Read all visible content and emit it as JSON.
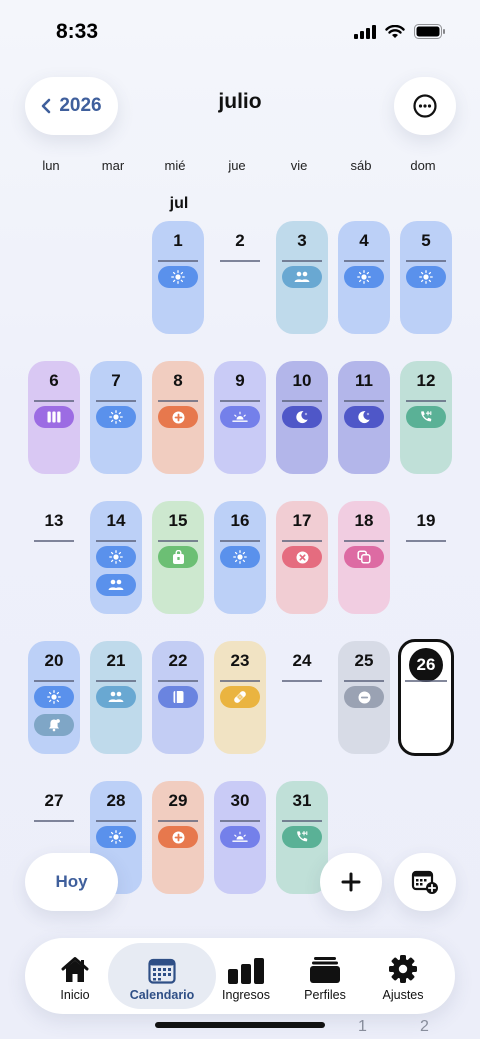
{
  "status_bar": {
    "time": "8:33"
  },
  "header": {
    "year_label": "2026",
    "month_title": "julio"
  },
  "weekdays": [
    "lun",
    "mar",
    "mié",
    "jue",
    "vie",
    "sáb",
    "dom"
  ],
  "month_short": "jul",
  "days": [
    {
      "day": "1",
      "colors": [
        "#bcd0f7",
        "#5a91ec"
      ],
      "badges": [
        "sun-icon"
      ]
    },
    {
      "day": "2",
      "colors": null,
      "badges": []
    },
    {
      "day": "3",
      "colors": [
        "#bfdaeb",
        "#69a8d2"
      ],
      "badges": [
        "people-icon"
      ]
    },
    {
      "day": "4",
      "colors": [
        "#bcd0f7",
        "#5a91ec"
      ],
      "badges": [
        "sun-icon"
      ]
    },
    {
      "day": "5",
      "colors": [
        "#bcd0f7",
        "#5a91ec"
      ],
      "badges": [
        "sun-icon"
      ]
    },
    {
      "day": "6",
      "colors": [
        "#d9c8f3",
        "#9c6ce3"
      ],
      "badges": [
        "columns-icon"
      ]
    },
    {
      "day": "7",
      "colors": [
        "#bcd0f7",
        "#5a91ec"
      ],
      "badges": [
        "sun-icon"
      ]
    },
    {
      "day": "8",
      "colors": [
        "#f1cdc0",
        "#e7784d"
      ],
      "badges": [
        "plus-circle-icon"
      ]
    },
    {
      "day": "9",
      "colors": [
        "#c9cbf6",
        "#7480ea"
      ],
      "badges": [
        "sunrise-icon"
      ]
    },
    {
      "day": "10",
      "colors": [
        "#b3b6ea",
        "#4f57c8"
      ],
      "badges": [
        "moon-icon"
      ]
    },
    {
      "day": "11",
      "colors": [
        "#b3b6ea",
        "#4f57c8"
      ],
      "badges": [
        "moon-icon"
      ]
    },
    {
      "day": "12",
      "colors": [
        "#c0e0d8",
        "#5ab196"
      ],
      "badges": [
        "phone-icon"
      ]
    },
    {
      "day": "13",
      "colors": null,
      "badges": []
    },
    {
      "day": "14",
      "colors": [
        "#bcd0f7",
        "#5a91ec"
      ],
      "badges": [
        "sun-icon",
        "people-icon"
      ]
    },
    {
      "day": "15",
      "colors": [
        "#cde8cf",
        "#6cbf74"
      ],
      "badges": [
        "bag-icon"
      ]
    },
    {
      "day": "16",
      "colors": [
        "#bcd0f7",
        "#5a91ec"
      ],
      "badges": [
        "sun-icon"
      ]
    },
    {
      "day": "17",
      "colors": [
        "#f1cdd3",
        "#e56c7f"
      ],
      "badges": [
        "x-circle-icon"
      ]
    },
    {
      "day": "18",
      "colors": [
        "#f1cde1",
        "#dd6ba3"
      ],
      "badges": [
        "copy-icon"
      ]
    },
    {
      "day": "19",
      "colors": null,
      "badges": []
    },
    {
      "day": "20",
      "colors": [
        "#bcd0f7",
        "#5a91ec"
      ],
      "badges": [
        "sun-icon",
        "bell-icon"
      ]
    },
    {
      "day": "21",
      "colors": [
        "#bfdaeb",
        "#69a8d2"
      ],
      "badges": [
        "people-icon"
      ]
    },
    {
      "day": "22",
      "colors": [
        "#c3cdf4",
        "#6a84e0"
      ],
      "badges": [
        "book-icon"
      ]
    },
    {
      "day": "23",
      "colors": [
        "#f1e3c3",
        "#eab440"
      ],
      "badges": [
        "bandage-icon"
      ]
    },
    {
      "day": "24",
      "colors": null,
      "badges": []
    },
    {
      "day": "25",
      "colors": [
        "#d7dbe6",
        "#9aa2b3"
      ],
      "badges": [
        "minus-circle-icon"
      ]
    },
    {
      "day": "26",
      "colors": null,
      "today": true,
      "badges": []
    },
    {
      "day": "27",
      "colors": null,
      "badges": []
    },
    {
      "day": "28",
      "colors": [
        "#bcd0f7",
        "#5a91ec"
      ],
      "badges": [
        "sun-icon"
      ]
    },
    {
      "day": "29",
      "colors": [
        "#f1cdc0",
        "#e7784d"
      ],
      "badges": [
        "plus-circle-icon"
      ]
    },
    {
      "day": "30",
      "colors": [
        "#c9cbf6",
        "#7480ea"
      ],
      "badges": [
        "sunrise-icon"
      ]
    },
    {
      "day": "31",
      "colors": [
        "#c0e0d8",
        "#5ab196"
      ],
      "badges": [
        "phone-icon"
      ]
    }
  ],
  "bell_badge_color": "#7fa6c6",
  "actions": {
    "today_label": "Hoy"
  },
  "tabbar": [
    {
      "label": "Inicio",
      "icon": "home-icon"
    },
    {
      "label": "Calendario",
      "icon": "calendar-icon",
      "active": true
    },
    {
      "label": "Ingresos",
      "icon": "bars-icon"
    },
    {
      "label": "Perfiles",
      "icon": "folders-icon"
    },
    {
      "label": "Ajustes",
      "icon": "gear-icon"
    }
  ],
  "behind_numbers": [
    "1",
    "2"
  ],
  "colors": {
    "accent": "#3f5f9c",
    "today_ring": "#111111"
  }
}
